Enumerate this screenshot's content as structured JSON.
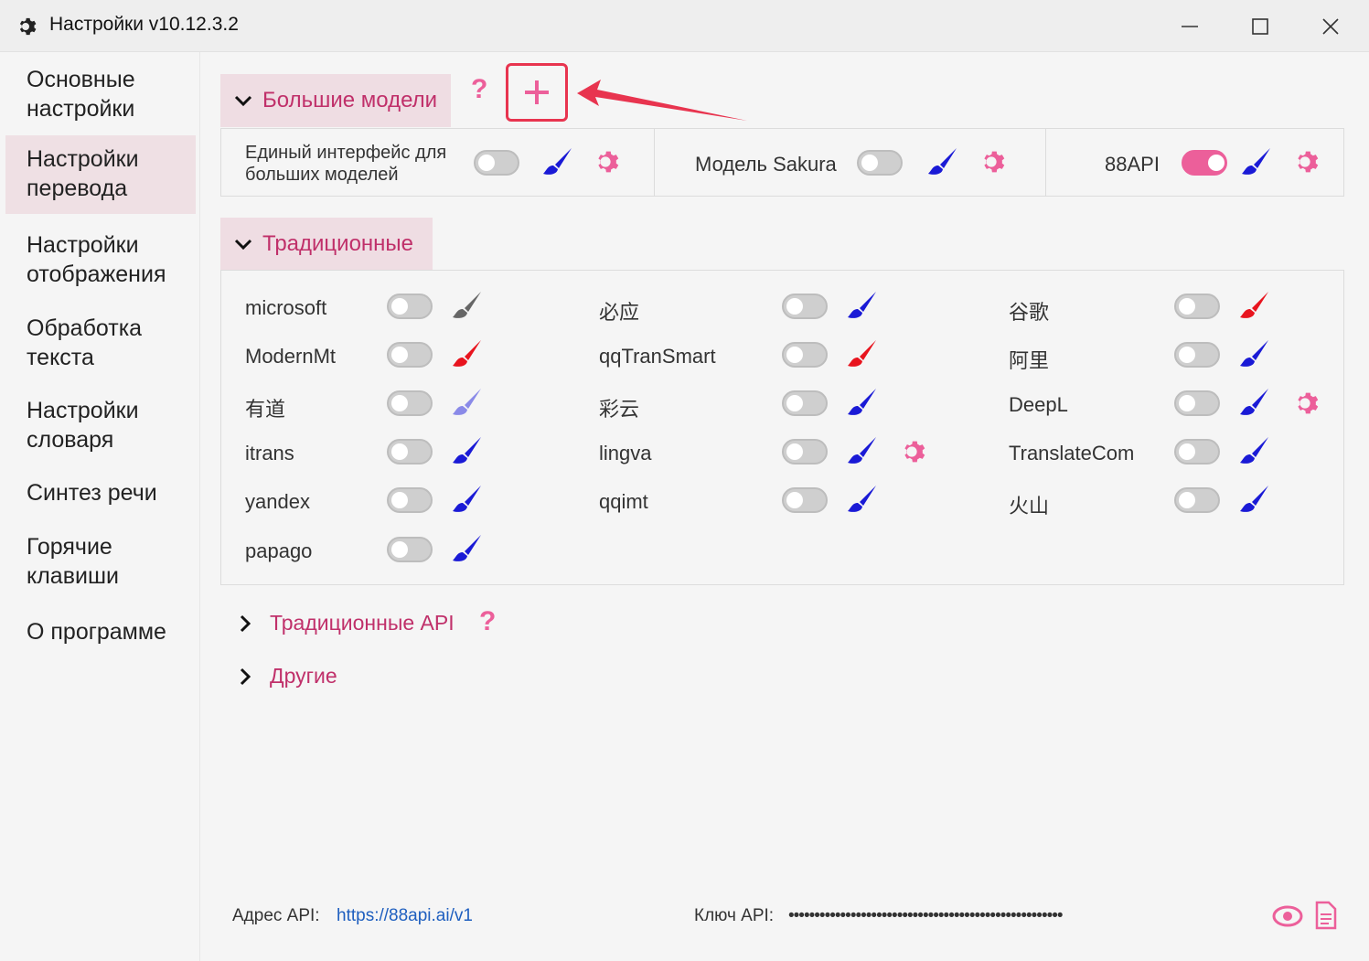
{
  "window": {
    "title": "Настройки v10.12.3.2",
    "icon": "gear-icon",
    "controls": [
      "minimize-icon",
      "maximize-icon",
      "close-icon"
    ]
  },
  "sidebar": {
    "items": [
      {
        "line1": "Основные",
        "line2": "настройки",
        "active": false
      },
      {
        "line1": "Настройки",
        "line2": "перевода",
        "active": true
      },
      {
        "line1": "Настройки",
        "line2": "отображения",
        "active": false
      },
      {
        "line1": "Обработка",
        "line2": "текста",
        "active": false
      },
      {
        "line1": "Настройки",
        "line2": "словаря",
        "active": false
      },
      {
        "line1": "Синтез речи",
        "line2": "",
        "active": false
      },
      {
        "line1": "Горячие",
        "line2": "клавиши",
        "active": false
      },
      {
        "line1": "О программе",
        "line2": "",
        "active": false
      }
    ]
  },
  "llm_section": {
    "title": "Большие модели",
    "help": "?",
    "add_icon": "plus-icon",
    "items": [
      {
        "label": "Единый интерфейс для больших моделей",
        "enabled": false
      },
      {
        "label": "Модель Sakura",
        "enabled": false
      },
      {
        "label": "88API",
        "enabled": true
      }
    ]
  },
  "traditional_section": {
    "title": "Традиционные",
    "items": [
      {
        "label": "microsoft",
        "enabled": false,
        "brush_color": "#666666"
      },
      {
        "label": "必应",
        "enabled": false,
        "brush_color": "#1a1ad6"
      },
      {
        "label": "谷歌",
        "enabled": false,
        "brush_color": "#e8141e"
      },
      {
        "label": "ModernMt",
        "enabled": false,
        "brush_color": "#e8141e"
      },
      {
        "label": "qqTranSmart",
        "enabled": false,
        "brush_color": "#e8141e"
      },
      {
        "label": "阿里",
        "enabled": false,
        "brush_color": "#1a1ad6"
      },
      {
        "label": "有道",
        "enabled": false,
        "brush_color": "#8a8ae8"
      },
      {
        "label": "彩云",
        "enabled": false,
        "brush_color": "#1a1ad6"
      },
      {
        "label": "DeepL",
        "enabled": false,
        "brush_color": "#1a1ad6"
      },
      {
        "label": "itrans",
        "enabled": false,
        "brush_color": "#1a1ad6"
      },
      {
        "label": "lingva",
        "enabled": false,
        "brush_color": "#1a1ad6"
      },
      {
        "label": "TranslateCom",
        "enabled": false,
        "brush_color": "#1a1ad6"
      },
      {
        "label": "yandex",
        "enabled": false,
        "brush_color": "#1a1ad6"
      },
      {
        "label": "qqimt",
        "enabled": false,
        "brush_color": "#1a1ad6"
      },
      {
        "label": "火山",
        "enabled": false,
        "brush_color": "#1a1ad6"
      },
      {
        "label": "papago",
        "enabled": false,
        "brush_color": "#1a1ad6"
      }
    ]
  },
  "traditional_api": {
    "title": "Традиционные API",
    "help": "?"
  },
  "others": {
    "title": "Другие"
  },
  "footer": {
    "api_address_label": "Адрес API:",
    "api_address_value": "https://88api.ai/v1",
    "api_key_label": "Ключ API:",
    "api_key_masked": "•••••••••••••••••••••••••••••••••••••••••••••••••••••",
    "show_icon": "eye-icon",
    "doc_icon": "document-icon"
  },
  "colors": {
    "accent": "#ec5f9a",
    "header_bg": "#efdde3",
    "header_text": "#c0306a",
    "highlight_box": "#e8344f",
    "link": "#1f5fbf"
  }
}
